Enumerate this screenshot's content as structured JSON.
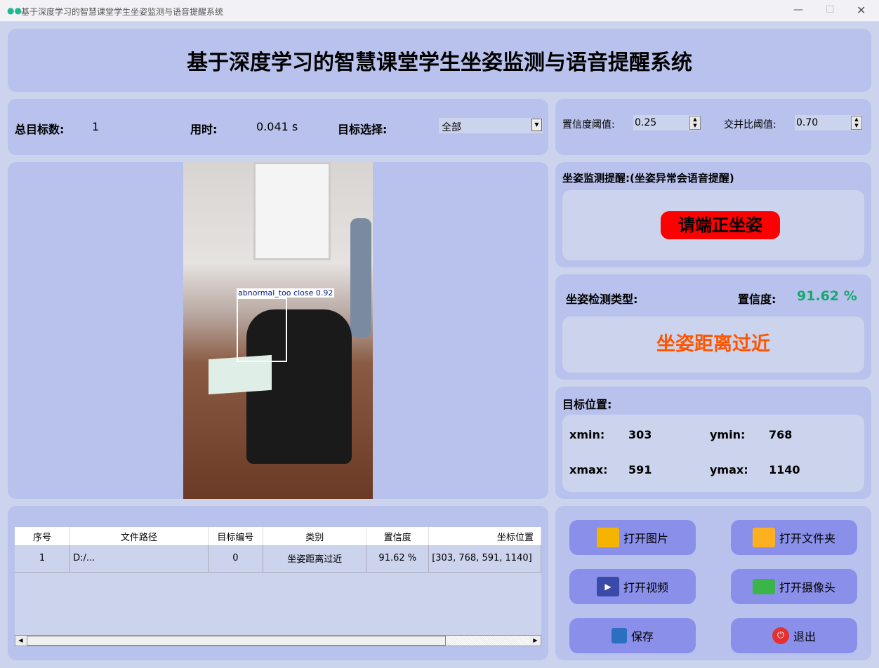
{
  "window": {
    "title": "基于深度学习的智慧课堂学生坐姿监测与语音提醒系统"
  },
  "header": {
    "title": "基于深度学习的智慧课堂学生坐姿监测与语音提醒系统"
  },
  "stats": {
    "total_label": "总目标数:",
    "total_value": "1",
    "time_label": "用时:",
    "time_value": "0.041 s",
    "select_label": "目标选择:",
    "select_value": "全部"
  },
  "thresholds": {
    "conf_label": "置信度阈值:",
    "conf_value": "0.25",
    "iou_label": "交并比阈值:",
    "iou_value": "0.70"
  },
  "image": {
    "detection_label": "abnormal_too close 0.92"
  },
  "alert": {
    "title": "坐姿监测提醒:(坐姿异常会语音提醒)",
    "message": "请端正坐姿"
  },
  "detection": {
    "type_label": "坐姿检测类型:",
    "conf_label": "置信度:",
    "conf_value": "91.62 %",
    "type_value": "坐姿距离过近"
  },
  "position": {
    "title": "目标位置:",
    "xmin_label": "xmin:",
    "xmin": "303",
    "ymin_label": "ymin:",
    "ymin": "768",
    "xmax_label": "xmax:",
    "xmax": "591",
    "ymax_label": "ymax:",
    "ymax": "1140"
  },
  "table": {
    "headers": [
      "序号",
      "文件路径",
      "目标编号",
      "类别",
      "置信度",
      "坐标位置"
    ],
    "rows": [
      [
        "1",
        "D:/...",
        "0",
        "坐姿距离过近",
        "91.62 %",
        "[303, 768, 591, 1140]"
      ]
    ]
  },
  "buttons": {
    "open_image": "打开图片",
    "open_folder": "打开文件夹",
    "open_video": "打开视频",
    "open_camera": "打开摄像头",
    "save": "保存",
    "exit": "退出"
  },
  "colors": {
    "accent_green": "#16a870",
    "alert_red": "#ff0000",
    "type_orange": "#ff5500",
    "button": "#8a90ea"
  }
}
